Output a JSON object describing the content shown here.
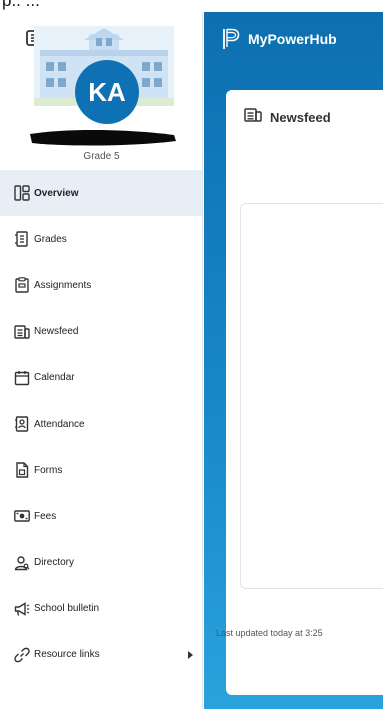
{
  "top_fragment": "p.. ...",
  "profile": {
    "initials": "KA",
    "grade": "Grade 5"
  },
  "nav": {
    "items": [
      {
        "key": "overview",
        "label": "Overview",
        "icon": "overview-icon",
        "active": true
      },
      {
        "key": "grades",
        "label": "Grades",
        "icon": "grades-icon"
      },
      {
        "key": "assignments",
        "label": "Assignments",
        "icon": "assignments-icon"
      },
      {
        "key": "newsfeed",
        "label": "Newsfeed",
        "icon": "newsfeed-icon"
      },
      {
        "key": "calendar",
        "label": "Calendar",
        "icon": "calendar-icon"
      },
      {
        "key": "attendance",
        "label": "Attendance",
        "icon": "attendance-icon"
      },
      {
        "key": "forms",
        "label": "Forms",
        "icon": "forms-icon"
      },
      {
        "key": "fees",
        "label": "Fees",
        "icon": "fees-icon"
      },
      {
        "key": "directory",
        "label": "Directory",
        "icon": "directory-icon"
      },
      {
        "key": "school-bulletin",
        "label": "School bulletin",
        "icon": "megaphone-icon"
      },
      {
        "key": "resource-links",
        "label": "Resource links",
        "icon": "links-icon",
        "has_submenu": true
      }
    ]
  },
  "brand": {
    "name": "MyPowerHub"
  },
  "newsfeed": {
    "title": "Newsfeed",
    "last_updated": "Last updated today at 3:25"
  },
  "colors": {
    "accent": "#0e71b3",
    "header_top": "#0d6fb0",
    "header_bottom": "#2aa2dc",
    "active_item_bg": "#e8eef6"
  }
}
